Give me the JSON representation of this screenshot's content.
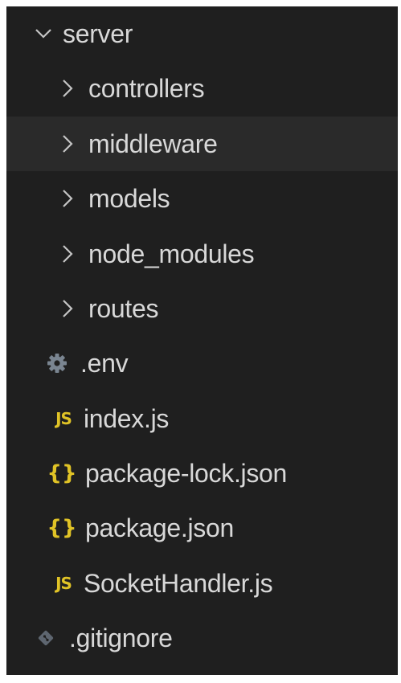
{
  "explorer": {
    "root": {
      "label": "server",
      "expanded": true,
      "icon": "chevron-down-icon"
    },
    "folders": [
      {
        "label": "controllers",
        "icon": "chevron-right-icon"
      },
      {
        "label": "middleware",
        "icon": "chevron-right-icon",
        "hovered": true
      },
      {
        "label": "models",
        "icon": "chevron-right-icon"
      },
      {
        "label": "node_modules",
        "icon": "chevron-right-icon"
      },
      {
        "label": "routes",
        "icon": "chevron-right-icon"
      }
    ],
    "files": [
      {
        "label": ".env",
        "icon": "gear-icon",
        "icon_color": "#7a8591"
      },
      {
        "label": "index.js",
        "icon": "javascript-file-icon",
        "badge": "JS",
        "icon_color": "#e0c326"
      },
      {
        "label": "package-lock.json",
        "icon": "json-file-icon",
        "badge": "{}",
        "icon_color": "#e0c326"
      },
      {
        "label": "package.json",
        "icon": "json-file-icon",
        "badge": "{}",
        "icon_color": "#e0c326"
      },
      {
        "label": "SocketHandler.js",
        "icon": "javascript-file-icon",
        "badge": "JS",
        "icon_color": "#e0c326"
      }
    ],
    "root_files": [
      {
        "label": ".gitignore",
        "icon": "git-file-icon",
        "icon_color": "#5e6670"
      }
    ]
  },
  "colors": {
    "background": "#1f1f1f",
    "hover_row": "#2a2a2a",
    "text": "#d8d8d8",
    "chevron": "#c5c5c5",
    "js_json_icon": "#e0c326",
    "gear_icon": "#7a8591",
    "git_icon": "#5e6670"
  }
}
